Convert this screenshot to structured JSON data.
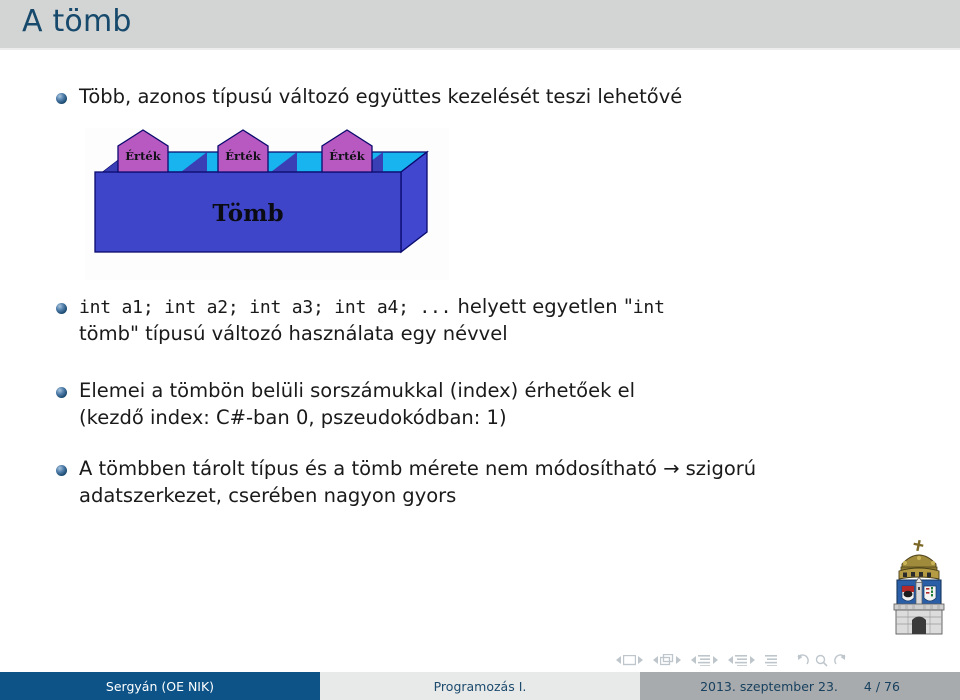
{
  "header": {
    "title": "A tömb",
    "title_color": "#16496b",
    "band_color": "#d3d5d4"
  },
  "bullets": [
    {
      "id": "b1",
      "text": "Több, azonos típusú változó együttes kezelését teszi lehetővé"
    },
    {
      "id": "b2",
      "code_1": "int a1; int a2; int a3; int a4; ...",
      "mid": " helyett egyetlen \"",
      "code_2": "int",
      "line2_a": "tömb\" típusú változó használata egy névvel"
    },
    {
      "id": "b3",
      "line1": "Elemei a tömbön belüli sorszámukkal (index) érhetőek el",
      "line2": "(kezdő index: C#-ban 0, pszeudokódban: 1)"
    },
    {
      "id": "b4",
      "line1": "A tömbben tárolt típus és a tömb mérete nem módosítható → szigorú",
      "line2": "adatszerkezet, cserében nagyon gyors"
    }
  ],
  "diagram": {
    "box_label": "Tömb",
    "value_labels": [
      "Érték",
      "Érték",
      "Érték"
    ],
    "box_front_color": "#3e45c8",
    "box_top_color": "#3b3fb5",
    "box_side_color": "#4147cf",
    "slot_color": "#17b4ef",
    "value_color": "#b759c0",
    "outline_color": "#0a0a6e"
  },
  "navigation": {
    "items": [
      "prev-frame-icon",
      "frame-icon",
      "next-frame-icon",
      "prev-slide-icon",
      "slide-icon",
      "next-slide-icon",
      "prev-subsection-icon",
      "subsection-icon",
      "next-subsection-icon",
      "prev-section-icon",
      "section-icon",
      "next-section-icon",
      "toc-icon",
      "back-icon",
      "search-icon",
      "forward-icon"
    ]
  },
  "logo": {
    "name": "obuda-university-coat-of-arms"
  },
  "footer": {
    "author": "Sergyán  (OE NIK)",
    "subject": "Programozás I.",
    "date": "2013. szeptember 23.",
    "page": "4 / 76",
    "author_bg": "#0d5387",
    "subject_bg": "#e8e9e9",
    "date_bg": "#a8abad"
  }
}
